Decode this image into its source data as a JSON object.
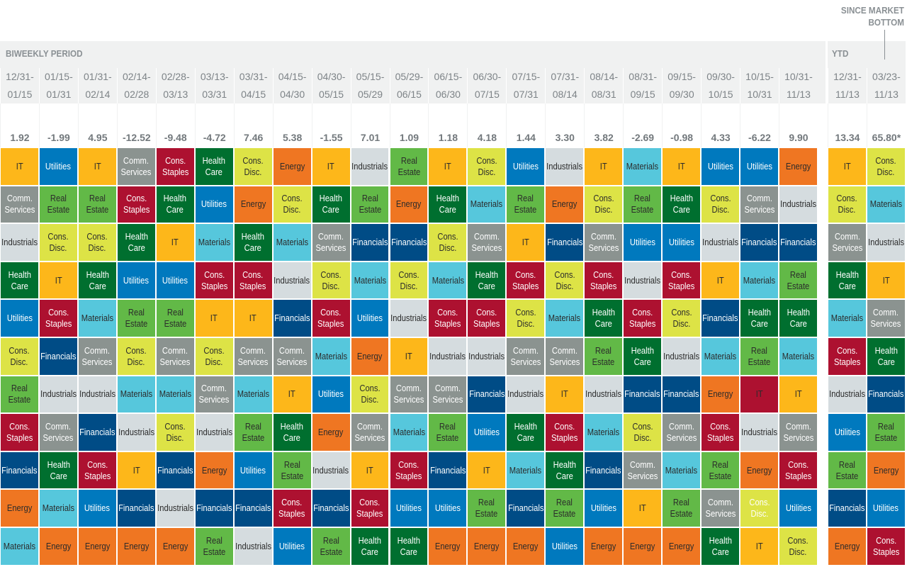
{
  "header": {
    "biweekly_title": "BIWEEKLY PERIOD",
    "ytd_title": "YTD",
    "since_title": "SINCE MARKET\nBOTTOM"
  },
  "chart_data": {
    "type": "table",
    "description_rows": "sector rank per period, best to worst",
    "colors": {
      "IT": "#fdb71a",
      "Utilities": "#0079be",
      "Comm.\nServices": "#8b9390",
      "Cons.\nStaples": "#ad1130",
      "Health\nCare": "#006f2f",
      "Cons.\nDisc.": "#dde346",
      "Energy": "#ef7622",
      "Industrials": "#d5dcdf",
      "Real\nEstate": "#62b947",
      "Materials": "#56c7dc",
      "Financials": "#004c86"
    },
    "dark_text": [
      "IT",
      "Cons.\nDisc.",
      "Energy",
      "Industrials",
      "Real\nEstate",
      "Materials"
    ],
    "columns": [
      {
        "period": "12/31-\n01/15",
        "value": "1.92",
        "cells": [
          "IT",
          "Comm.\nServices",
          "Industrials",
          "Health\nCare",
          "Utilities",
          "Cons.\nDisc.",
          "Real\nEstate",
          "Cons.\nStaples",
          "Financials",
          "Energy",
          "Materials"
        ]
      },
      {
        "period": "01/15-\n01/31",
        "value": "-1.99",
        "cells": [
          "Utilities",
          "Real\nEstate",
          "Cons.\nDisc.",
          "IT",
          "Cons.\nStaples",
          "Financials",
          "Industrials",
          "Comm.\nServices",
          "Health\nCare",
          "Materials",
          "Energy"
        ]
      },
      {
        "period": "01/31-\n02/14",
        "value": "4.95",
        "cells": [
          "IT",
          "Real\nEstate",
          "Cons.\nDisc.",
          "Health\nCare",
          "Materials",
          "Comm.\nServices",
          "Industrials",
          "Financials",
          "Cons.\nStaples",
          "Utilities",
          "Energy"
        ]
      },
      {
        "period": "02/14-\n02/28",
        "value": "-12.52",
        "cells": [
          "Comm.\nServices",
          "Cons.\nStaples",
          "Health\nCare",
          "Utilities",
          "Real\nEstate",
          "Cons.\nDisc.",
          "Materials",
          "Industrials",
          "IT",
          "Financials",
          "Energy"
        ]
      },
      {
        "period": "02/28-\n03/13",
        "value": "-9.48",
        "cells": [
          "Cons.\nStaples",
          "Health\nCare",
          "IT",
          "Utilities",
          "Real\nEstate",
          "Comm.\nServices",
          "Materials",
          "Cons.\nDisc.",
          "Financials",
          "Industrials",
          "Energy"
        ]
      },
      {
        "period": "03/13-\n03/31",
        "value": "-4.72",
        "cells": [
          "Health\nCare",
          "Utilities",
          "Materials",
          "Cons.\nStaples",
          "IT",
          "Cons.\nDisc.",
          "Comm.\nServices",
          "Industrials",
          "Energy",
          "Financials",
          "Real\nEstate"
        ]
      },
      {
        "period": "03/31-\n04/15",
        "value": "7.46",
        "cells": [
          "Cons.\nDisc.",
          "Energy",
          "Health\nCare",
          "Cons.\nStaples",
          "IT",
          "Comm.\nServices",
          "Materials",
          "Real\nEstate",
          "Utilities",
          "Financials",
          "Industrials"
        ]
      },
      {
        "period": "04/15-\n04/30",
        "value": "5.38",
        "cells": [
          "Energy",
          "Cons.\nDisc.",
          "Materials",
          "Industrials",
          "Financials",
          "Comm.\nServices",
          "IT",
          "Health\nCare",
          "Real\nEstate",
          "Cons.\nStaples",
          "Utilities"
        ]
      },
      {
        "period": "04/30-\n05/15",
        "value": "-1.55",
        "cells": [
          "IT",
          "Health\nCare",
          "Comm.\nServices",
          "Cons.\nDisc.",
          "Cons.\nStaples",
          "Materials",
          "Utilities",
          "Energy",
          "Industrials",
          "Financials",
          "Real\nEstate"
        ]
      },
      {
        "period": "05/15-\n05/29",
        "value": "7.01",
        "cells": [
          "Industrials",
          "Real\nEstate",
          "Financials",
          "Materials",
          "Utilities",
          "Energy",
          "Cons.\nDisc.",
          "Comm.\nServices",
          "IT",
          "Cons.\nStaples",
          "Health\nCare"
        ]
      },
      {
        "period": "05/29-\n06/15",
        "value": "1.09",
        "cells": [
          "Real\nEstate",
          "Energy",
          "Financials",
          "Cons.\nDisc.",
          "Industrials",
          "IT",
          "Comm.\nServices",
          "Materials",
          "Cons.\nStaples",
          "Utilities",
          "Health\nCare"
        ]
      },
      {
        "period": "06/15-\n06/30",
        "value": "1.18",
        "cells": [
          "IT",
          "Health\nCare",
          "Cons.\nDisc.",
          "Materials",
          "Cons.\nStaples",
          "Industrials",
          "Comm.\nServices",
          "Real\nEstate",
          "Financials",
          "Utilities",
          "Energy"
        ]
      },
      {
        "period": "06/30-\n07/15",
        "value": "4.18",
        "cells": [
          "Cons.\nDisc.",
          "Materials",
          "Comm.\nServices",
          "Health\nCare",
          "Cons.\nStaples",
          "Industrials",
          "Financials",
          "Utilities",
          "IT",
          "Real\nEstate",
          "Energy"
        ]
      },
      {
        "period": "07/15-\n07/31",
        "value": "1.44",
        "cells": [
          "Utilities",
          "Real\nEstate",
          "IT",
          "Cons.\nStaples",
          "Cons.\nDisc.",
          "Comm.\nServices",
          "Industrials",
          "Health\nCare",
          "Materials",
          "Financials",
          "Energy"
        ]
      },
      {
        "period": "07/31-\n08/14",
        "value": "3.30",
        "cells": [
          "Industrials",
          "Energy",
          "Financials",
          "Cons.\nDisc.",
          "Materials",
          "Comm.\nServices",
          "IT",
          "Cons.\nStaples",
          "Health\nCare",
          "Real\nEstate",
          "Utilities"
        ]
      },
      {
        "period": "08/14-\n08/31",
        "value": "3.82",
        "cells": [
          "IT",
          "Cons.\nDisc.",
          "Comm.\nServices",
          "Cons.\nStaples",
          "Health\nCare",
          "Real\nEstate",
          "Industrials",
          "Materials",
          "Financials",
          "Utilities",
          "Energy"
        ]
      },
      {
        "period": "08/31-\n09/15",
        "value": "-2.69",
        "cells": [
          "Materials",
          "Real\nEstate",
          "Utilities",
          "Industrials",
          "Cons.\nStaples",
          "Health\nCare",
          "Financials",
          "Cons.\nDisc.",
          "Comm.\nServices",
          "IT",
          "Energy"
        ]
      },
      {
        "period": "09/15-\n09/30",
        "value": "-0.98",
        "cells": [
          "IT",
          "Health\nCare",
          "Utilities",
          "Cons.\nStaples",
          "Cons.\nDisc.",
          "Industrials",
          "Financials",
          "Comm.\nServices",
          "Materials",
          "Real\nEstate",
          "Energy"
        ]
      },
      {
        "period": "09/30-\n10/15",
        "value": "4.33",
        "cells": [
          "Utilities",
          "Cons.\nDisc.",
          "Industrials",
          "IT",
          "Financials",
          "Materials",
          "Energy",
          "Cons.\nStaples",
          "Real\nEstate",
          "Comm.\nServices",
          "Health\nCare"
        ]
      },
      {
        "period": "10/15-\n10/31",
        "value": "-6.22",
        "cells": [
          "Utilities",
          "Comm.\nServices",
          "Financials",
          "Materials",
          "Health\nCare",
          "Real\nEstate",
          "IT",
          "Industrials",
          "Energy",
          "Cons.\nDisc.",
          "IT"
        ]
      },
      {
        "period": "10/31-\n11/13",
        "value": "9.90",
        "cells": [
          "Energy",
          "Industrials",
          "Financials",
          "Real\nEstate",
          "Health\nCare",
          "Materials",
          "IT",
          "Comm.\nServices",
          "Cons.\nStaples",
          "Utilities",
          "Cons.\nDisc."
        ]
      },
      {
        "period": "12/31-\n11/13",
        "value": "13.34",
        "group": "ytd",
        "cells": [
          "IT",
          "Cons.\nDisc.",
          "Comm.\nServices",
          "Health\nCare",
          "Materials",
          "Cons.\nStaples",
          "Industrials",
          "Utilities",
          "Real\nEstate",
          "Financials",
          "Energy"
        ]
      },
      {
        "period": "03/23-\n11/13",
        "value": "65.80*",
        "group": "since",
        "cells": [
          "Cons.\nDisc.",
          "Materials",
          "Industrials",
          "IT",
          "Comm.\nServices",
          "Health\nCare",
          "Financials",
          "Real\nEstate",
          "Energy",
          "Utilities",
          "Cons.\nStaples"
        ]
      }
    ],
    "overrides": [
      {
        "col": 19,
        "row": 6,
        "color": "Cons.\nStaples",
        "text": "dark"
      },
      {
        "col": 19,
        "row": 9,
        "color": "Cons.\nDisc.",
        "text": "light"
      }
    ]
  }
}
